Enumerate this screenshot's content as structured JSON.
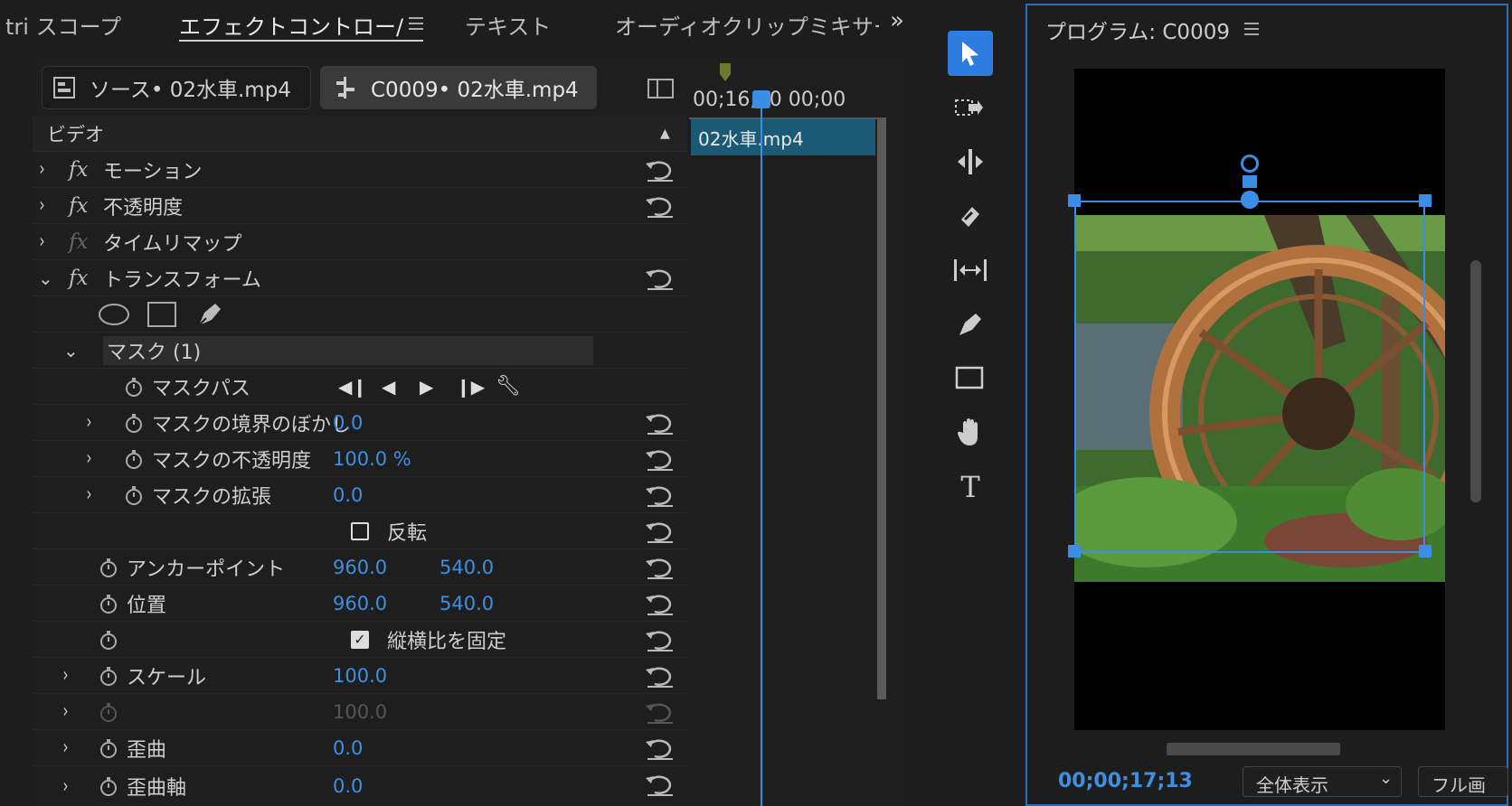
{
  "tabs": {
    "scopes": "tri スコープ",
    "effect_controls": "エフェクトコントロー/",
    "text": "テキスト",
    "audio_mixer": "オーディオクリップミキサー"
  },
  "source_tab": "ソース• 02水車.mp4",
  "sequence_tab": "C0009• 02水車.mp4",
  "section_video": "ビデオ",
  "effects": [
    {
      "label": "モーション"
    },
    {
      "label": "不透明度"
    },
    {
      "label": "タイムリマップ"
    },
    {
      "label": "トランスフォーム"
    }
  ],
  "mask": {
    "label": "マスク (1)",
    "path_label": "マスクパス",
    "feather": {
      "label": "マスクの境界のぼかし",
      "value": "0.0"
    },
    "opacity": {
      "label": "マスクの不透明度",
      "value": "100.0 %"
    },
    "expansion": {
      "label": "マスクの拡張",
      "value": "0.0"
    },
    "invert": {
      "label": "反転"
    }
  },
  "anchor": {
    "label": "アンカーポイント",
    "x": "960.0",
    "y": "540.0"
  },
  "position": {
    "label": "位置",
    "x": "960.0",
    "y": "540.0"
  },
  "uniform_scale": {
    "label": "縦横比を固定"
  },
  "scale": {
    "label": "スケール",
    "value": "100.0"
  },
  "scale_width": {
    "value": "100.0"
  },
  "skew": {
    "label": "歪曲",
    "value": "0.0"
  },
  "skew_axis": {
    "label": "歪曲軸",
    "value": "0.0"
  },
  "timeline": {
    "timecode": "00;16;00 00;00",
    "clip_name": "02水車.mp4"
  },
  "program": {
    "title": "プログラム: C0009",
    "timecode": "00;00;17;13",
    "zoom": "全体表示",
    "quality": "フル画"
  },
  "colors": {
    "accent": "#3a8ee6",
    "value_blue": "#3f8fe0",
    "clip_teal": "#1b5a74"
  },
  "icons": [
    "menu-icon",
    "overflow-chevrons-icon",
    "panel-toggle-icon",
    "stopwatch-icon",
    "reset-icon",
    "selection-tool-icon",
    "track-select-tool-icon",
    "ripple-edit-tool-icon",
    "razor-tool-icon",
    "slip-tool-icon",
    "pen-tool-icon",
    "rectangle-tool-icon",
    "hand-tool-icon",
    "type-tool-icon"
  ]
}
